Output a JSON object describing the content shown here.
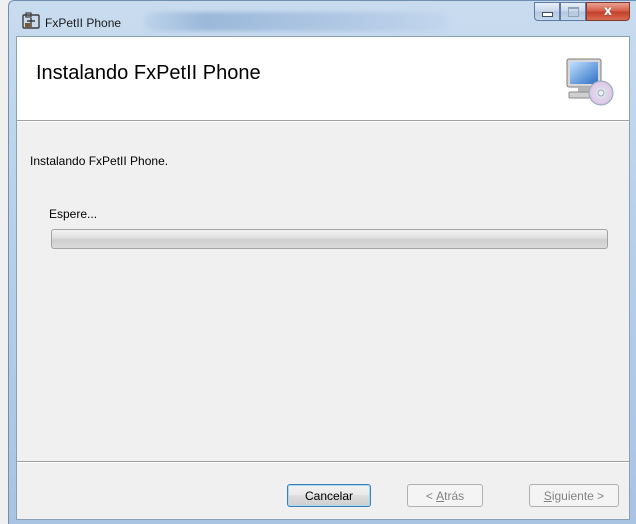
{
  "window": {
    "title": "FxPetII Phone",
    "controls": {
      "minimize_icon": "minimize-icon",
      "maximize_icon": "maximize-icon",
      "close_icon": "close-icon",
      "close_glyph": "x"
    }
  },
  "banner": {
    "title": "Instalando FxPetII Phone",
    "icon": "computer-cd-icon"
  },
  "body": {
    "status": "Instalando FxPetII Phone.",
    "wait_label": "Espere...",
    "progress_fraction": 0.0
  },
  "buttons": {
    "cancel_label": "Cancelar",
    "back_mnemonic": "A",
    "back_prefix": "< ",
    "back_rest": "trás",
    "next_mnemonic": "S",
    "next_rest": "iguiente >"
  },
  "colors": {
    "title_bar": "#b9d1ea",
    "close_button": "#c4412a",
    "progress_fill": "#20b11a"
  }
}
